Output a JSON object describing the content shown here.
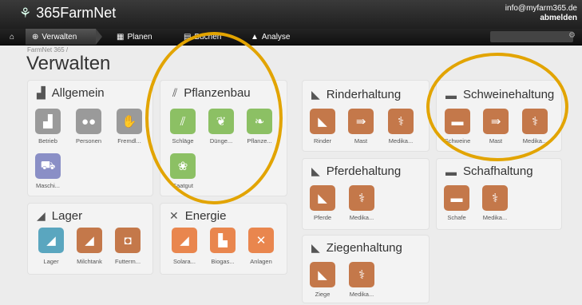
{
  "header": {
    "brand": "365FarmNet",
    "email": "info@myfarm365.de",
    "logout": "abmelden"
  },
  "nav": {
    "items": [
      {
        "label": "Verwalten"
      },
      {
        "label": "Planen"
      },
      {
        "label": "Buchen"
      },
      {
        "label": "Analyse"
      }
    ]
  },
  "breadcrumb": "FarmNet 365 /",
  "page_title": "Verwalten",
  "colors": {
    "gray": "#9a9a9a",
    "purple": "#8a8fc6",
    "teal": "#5aa6bf",
    "brown": "#c4784a",
    "green": "#8cc064",
    "orange": "#e9864e",
    "highlight": "#e2a400"
  },
  "panels": {
    "allgemein": {
      "title": "Allgemein",
      "tiles": [
        "Betrieb",
        "Personen",
        "Fremdl...",
        "Maschi..."
      ]
    },
    "pflanzenbau": {
      "title": "Pflanzenbau",
      "tiles": [
        "Schläge",
        "Dünge...",
        "Pflanze...",
        "Saatgut"
      ]
    },
    "rinderhaltung": {
      "title": "Rinderhaltung",
      "tiles": [
        "Rinder",
        "Mast",
        "Medika..."
      ]
    },
    "schweinehaltung": {
      "title": "Schweinehaltung",
      "tiles": [
        "Schweine",
        "Mast",
        "Medika..."
      ]
    },
    "pferdehaltung": {
      "title": "Pferdehaltung",
      "tiles": [
        "Pferde",
        "Medika..."
      ]
    },
    "schafhaltung": {
      "title": "Schafhaltung",
      "tiles": [
        "Schafe",
        "Medika..."
      ]
    },
    "lager": {
      "title": "Lager",
      "tiles": [
        "Lager",
        "Milchtank",
        "Futterm..."
      ]
    },
    "energie": {
      "title": "Energie",
      "tiles": [
        "Solara...",
        "Biogas...",
        "Anlagen"
      ]
    },
    "ziegenhaltung": {
      "title": "Ziegenhaltung",
      "tiles": [
        "Ziege",
        "Medika..."
      ]
    }
  }
}
